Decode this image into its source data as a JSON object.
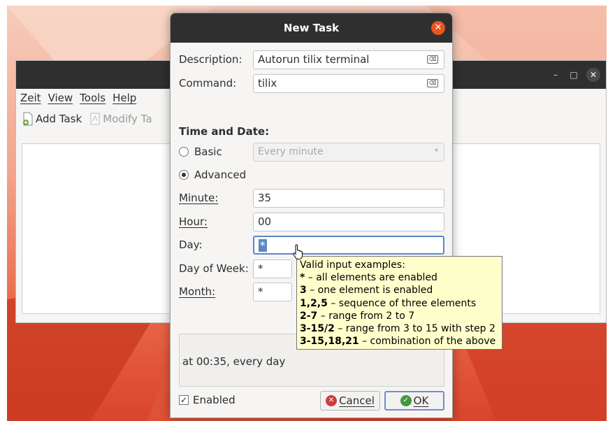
{
  "background_window": {
    "menu": [
      "Zeit",
      "View",
      "Tools",
      "Help"
    ],
    "toolbar": {
      "add_task": "Add Task",
      "modify_task": "Modify Ta"
    },
    "window_controls": {
      "minimize": "–",
      "maximize": "□",
      "close": "✕"
    }
  },
  "dialog": {
    "title": "New Task",
    "close_glyph": "✕",
    "description_label": "Description:",
    "description_value": "Autorun tilix terminal",
    "command_label": "Command:",
    "command_value": "tilix",
    "clear_glyph": "⌫",
    "time_section": "Time and Date:",
    "basic_label": "Basic",
    "basic_select_value": "Every minute",
    "select_arrow": "▾",
    "advanced_label": "Advanced",
    "minute_label": "Minute:",
    "minute_value": "35",
    "hour_label": "Hour:",
    "hour_value": "00",
    "day_label": "Day:",
    "day_value": "*",
    "dow_label": "Day of Week:",
    "dow_value": "*",
    "month_label": "Month:",
    "month_value": "*",
    "summary_text": "at 00:35, every day",
    "enabled_label": "Enabled",
    "enabled_check": "✓",
    "cancel_label": "Cancel",
    "ok_label": "OK"
  },
  "tooltip": {
    "heading": "Valid input examples:",
    "rows": [
      {
        "key": "*",
        "desc": " – all elements are enabled"
      },
      {
        "key": "3",
        "desc": " – one element is enabled"
      },
      {
        "key": "1,2,5",
        "desc": " – sequence of three elements"
      },
      {
        "key": "2-7",
        "desc": " – range from 2 to 7"
      },
      {
        "key": "3-15/2",
        "desc": " – range from 3 to 15 with step 2"
      },
      {
        "key": "3-15,18,21",
        "desc": " – combination of the above"
      }
    ]
  },
  "colors": {
    "accent": "#e95420",
    "titlebar": "#2f2f2f",
    "tooltip_bg": "#ffffcc"
  }
}
